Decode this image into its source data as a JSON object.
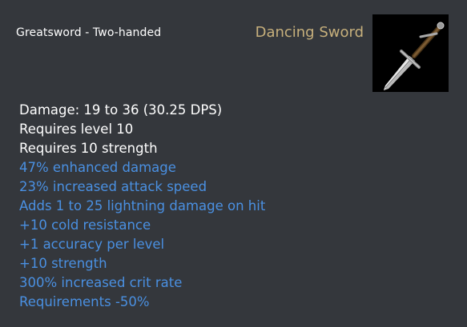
{
  "tooltip": {
    "item_type": "Greatsword - Two-handed",
    "item_name": "Dancing Sword",
    "icon": "greatsword-icon",
    "colors": {
      "background": "#34373c",
      "name": "#c7b07c",
      "base_stat": "#ffffff",
      "magic_stat": "#4a90e2"
    },
    "base_stats": [
      "Damage: 19 to 36 (30.25 DPS)",
      "Requires level 10",
      "Requires 10 strength"
    ],
    "magic_stats": [
      "47% enhanced damage",
      "23% increased attack speed",
      "Adds 1 to 25 lightning damage on hit",
      "+10 cold resistance",
      "+1 accuracy per level",
      "+10 strength",
      "300% increased crit rate",
      "Requirements -50%"
    ]
  }
}
